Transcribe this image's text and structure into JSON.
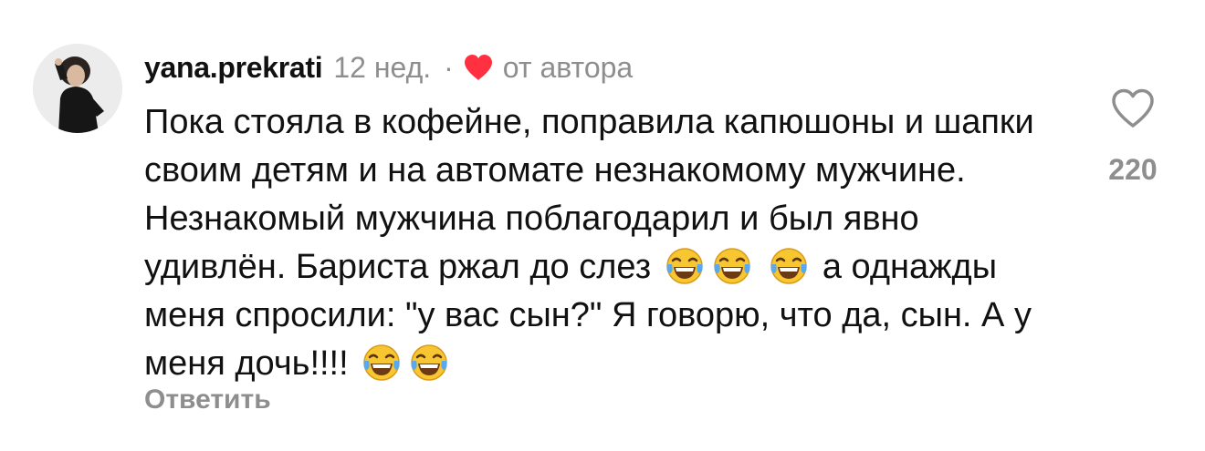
{
  "comment": {
    "username": "yana.prekrati",
    "time": "12 нед.",
    "separator": "·",
    "author_badge": "от автора",
    "text_part1": "Пока стояла в кофейне, поправила капюшоны и шапки своим детям и на автомате незнакомому мужчине. Незнакомый мужчина поблагодарил и был явно удивлён. Бариста ржал до слез",
    "text_part2": "а однажды меня спросили: \"у вас сын?\" Я говорю, что да, сын. А у меня дочь!!!!",
    "reply_label": "Ответить",
    "like_count": "220",
    "heart_color": "#ff3040",
    "muted_color": "#8e8e8e"
  },
  "icons": {
    "avatar": "avatar",
    "author_heart": "heart-filled-icon",
    "like": "heart-outline-icon",
    "emoji": "laughing-tears-emoji"
  }
}
